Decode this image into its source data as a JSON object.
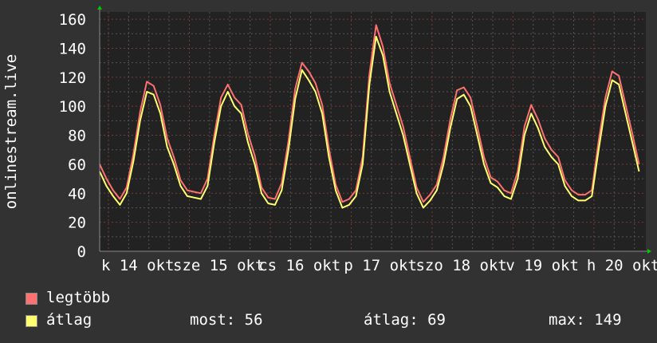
{
  "chart_data": {
    "type": "line",
    "ylabel": "onlinestream.live",
    "ylim": [
      0,
      165
    ],
    "yticks": [
      0,
      20,
      40,
      60,
      80,
      100,
      120,
      140,
      160
    ],
    "x_unit": "hours since start",
    "xlim": [
      0,
      162
    ],
    "day_start_hours": [
      2.6,
      26.6,
      50.6,
      74.6,
      98.6,
      122.6,
      146.6
    ],
    "xtick_labels": [
      "k 14 okt",
      "sze 15 okt",
      "cs 16 okt",
      "p 17 okt",
      "szo 18 okt",
      "v 19 okt",
      "h 20 okt"
    ],
    "x_step_hours": 2,
    "grid": true,
    "series": [
      {
        "name": "legtöbb",
        "color": "#ff7070",
        "values": [
          60,
          50,
          42,
          36,
          44,
          67,
          96,
          117,
          114,
          101,
          78,
          65,
          49,
          42,
          41,
          40,
          50,
          80,
          106,
          115,
          106,
          101,
          81,
          66,
          44,
          37,
          36,
          47,
          76,
          112,
          130,
          124,
          116,
          101,
          71,
          46,
          34,
          36,
          42,
          65,
          122,
          156,
          141,
          116,
          101,
          86,
          65,
          44,
          34,
          39,
          46,
          65,
          91,
          111,
          113,
          106,
          86,
          65,
          51,
          48,
          42,
          40,
          55,
          86,
          101,
          91,
          78,
          70,
          65,
          49,
          42,
          39,
          39,
          42,
          76,
          106,
          124,
          121,
          101,
          81,
          60
        ]
      },
      {
        "name": "átlag",
        "color": "#ffff70",
        "values": [
          55,
          45,
          38,
          32,
          40,
          62,
          90,
          110,
          108,
          95,
          72,
          60,
          45,
          38,
          37,
          36,
          45,
          75,
          100,
          110,
          100,
          95,
          75,
          60,
          40,
          33,
          32,
          42,
          70,
          105,
          125,
          118,
          110,
          95,
          65,
          42,
          30,
          32,
          38,
          60,
          115,
          148,
          135,
          110,
          95,
          80,
          60,
          40,
          30,
          35,
          42,
          60,
          85,
          105,
          108,
          100,
          80,
          60,
          47,
          44,
          38,
          36,
          50,
          80,
          95,
          85,
          72,
          65,
          60,
          45,
          38,
          35,
          35,
          38,
          70,
          100,
          118,
          115,
          95,
          75,
          55
        ]
      }
    ]
  },
  "legend": {
    "max_label": "legtöbb",
    "avg_label": "átlag",
    "now": "most: 56",
    "average": "átlag: 69",
    "maximum": "max: 149"
  }
}
